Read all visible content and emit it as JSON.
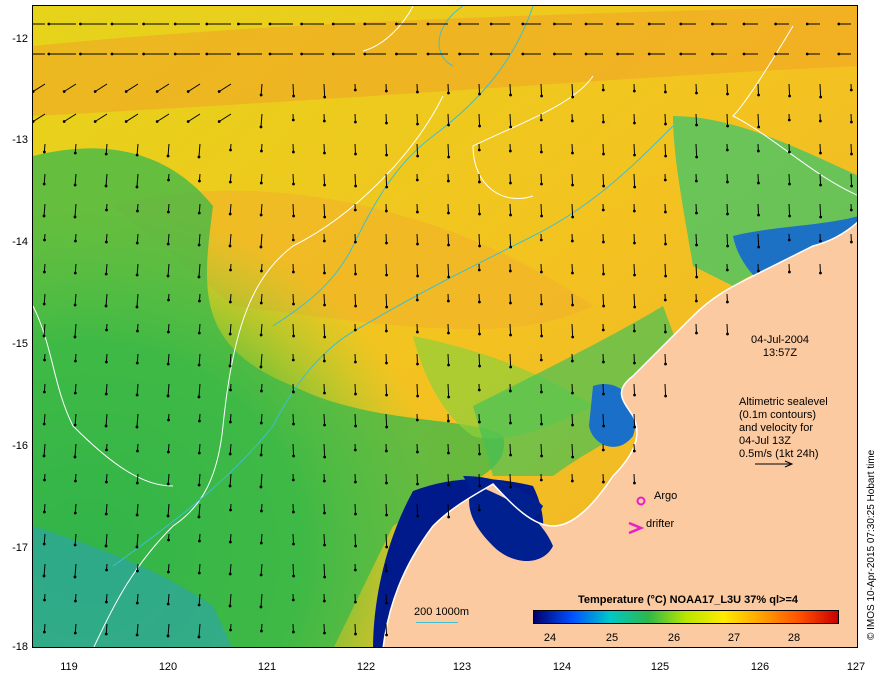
{
  "map": {
    "lat_ticks": [
      "-12",
      "-13",
      "-14",
      "-15",
      "-16",
      "-17",
      "-18"
    ],
    "lon_ticks": [
      "119",
      "120",
      "121",
      "122",
      "123",
      "124",
      "125",
      "126",
      "127"
    ],
    "date": "04-Jul-2004",
    "time": "13:57Z",
    "info_lines": [
      "Altimetric sealevel",
      "(0.1m contours)",
      "and velocity for",
      "04-Jul 13Z",
      "0.5m/s (1kt 24h)"
    ],
    "argo_label": "Argo",
    "drifter_label": "drifter",
    "depth_legend": "200  1000m",
    "credit": "© IMOS 10-Apr-2015 07:30:25 Hobart time",
    "land_color": "#fbcaa0",
    "ocean_warm_color": "#f2c11a",
    "ocean_cool_color": "#35b94a",
    "coastal_cold_color": "#001a8c",
    "contour_color": "#ffffff",
    "bathymetry_color": "#3fbfcf",
    "marker_color": "#e91ec8"
  },
  "colorbar": {
    "title": "Temperature (°C) NOAA17_L3U 37% ql>=4",
    "ticks": [
      "24",
      "25",
      "26",
      "27",
      "28"
    ],
    "colors": [
      "#00006e",
      "#0050ff",
      "#00c8c8",
      "#2db84a",
      "#b8e600",
      "#ffea00",
      "#ffa000",
      "#ff5000",
      "#c80000"
    ]
  }
}
